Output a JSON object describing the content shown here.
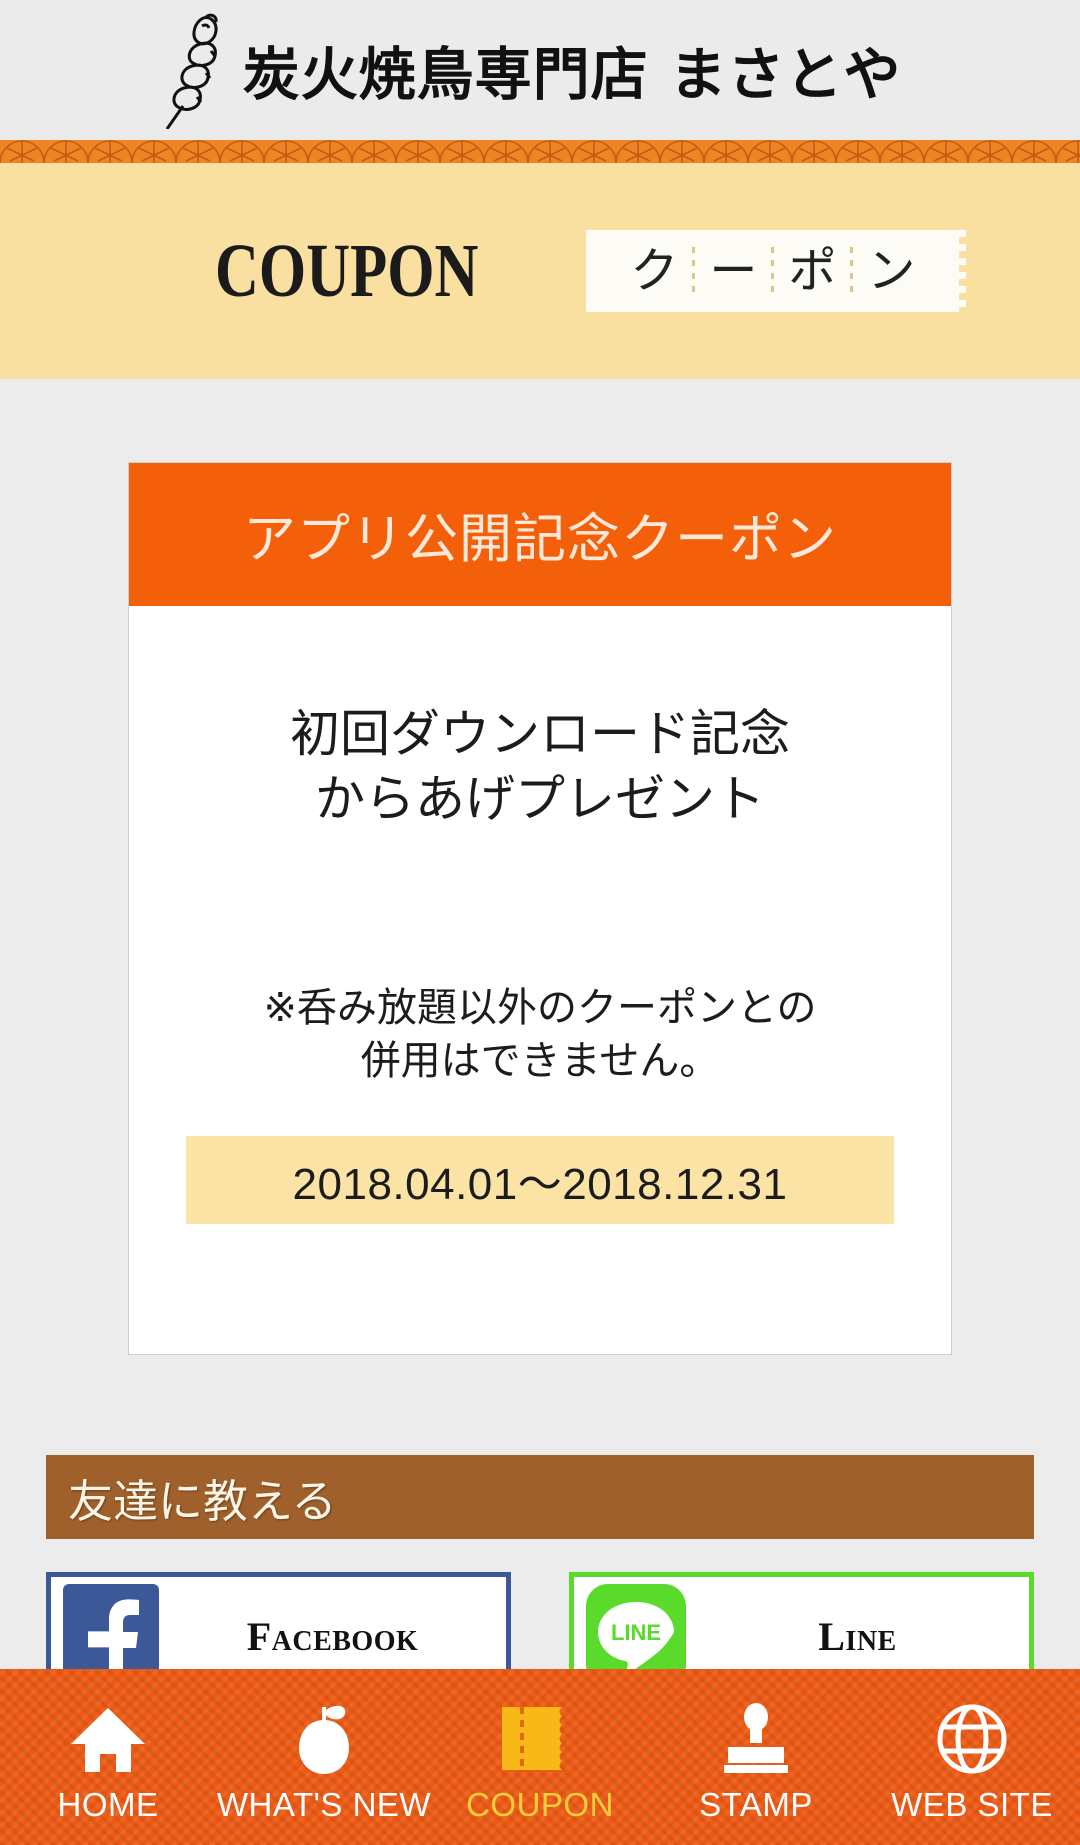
{
  "header": {
    "shop_name": "炭火焼鳥専門店 まさとや",
    "logo_icon": "yakitori-skewer-icon"
  },
  "page_title": {
    "english": "COUPON",
    "japanese_chars": [
      "ク",
      "ー",
      "ポ",
      "ン"
    ]
  },
  "coupon": {
    "heading": "アプリ公開記念クーポン",
    "main_line_1": "初回ダウンロード記念",
    "main_line_2": "からあげプレゼント",
    "note_line_1": "※呑み放題以外のクーポンとの",
    "note_line_2": "併用はできません。",
    "period": "2018.04.01〜2018.12.31"
  },
  "share": {
    "banner_label": "友達に教える",
    "buttons": [
      {
        "label": "Facebook",
        "icon": "facebook-icon",
        "color": "#3B5998"
      },
      {
        "label": "Line",
        "icon": "line-icon",
        "color": "#5ADB2C"
      }
    ]
  },
  "bottom_nav": {
    "active": "COUPON",
    "items": [
      {
        "label": "HOME",
        "icon": "home-icon"
      },
      {
        "label": "WHAT'S NEW",
        "icon": "apple-icon"
      },
      {
        "label": "COUPON",
        "icon": "ticket-icon"
      },
      {
        "label": "STAMP",
        "icon": "stamp-icon"
      },
      {
        "label": "WEB SITE",
        "icon": "globe-icon"
      }
    ]
  },
  "colors": {
    "brand_orange": "#F4600A",
    "nav_orange": "#EE5A14",
    "band_yellow": "#FAE0A0",
    "active_label": "#F9CE3B",
    "wood_brown": "#A0602C"
  }
}
